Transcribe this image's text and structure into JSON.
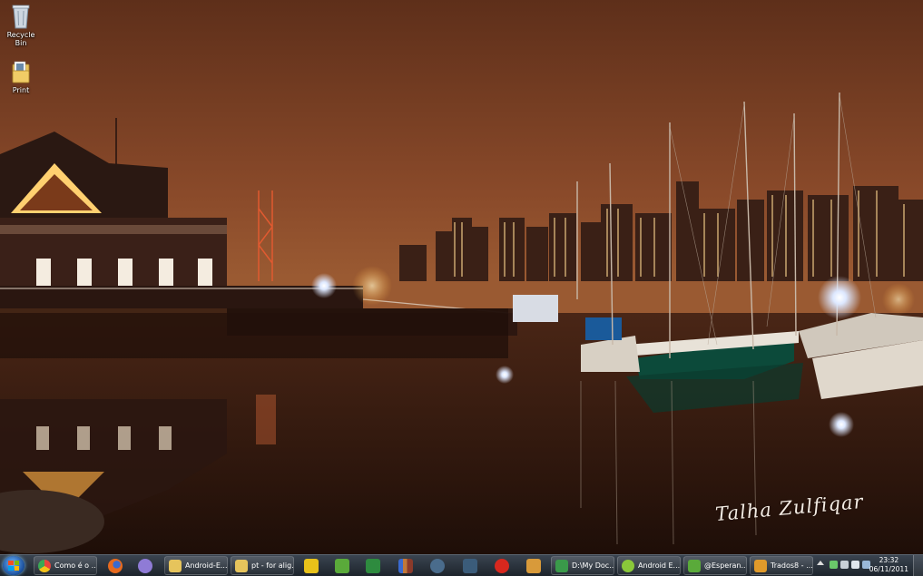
{
  "desktop": {
    "icons": [
      {
        "label": "Recycle Bin",
        "icon": "recycle-bin-icon"
      },
      {
        "label": "Print",
        "icon": "folder-print-icon"
      }
    ],
    "wallpaper": {
      "description_icon": "harbor-night-wallpaper",
      "signature": "Talha Zulfiqar"
    }
  },
  "taskbar": {
    "start_icon": "windows-start-icon",
    "buttons": [
      {
        "label": "Como é o ...",
        "icon": "chrome-icon",
        "color": "#e8453c"
      },
      {
        "label": "",
        "icon": "firefox-icon",
        "color": "#e66a1f"
      },
      {
        "label": "",
        "icon": "pidgin-icon",
        "color": "#8f7bd6"
      },
      {
        "label": "Android-E...",
        "icon": "folder-icon",
        "color": "#e6c45c"
      },
      {
        "label": "pt - for alig...",
        "icon": "folder-icon",
        "color": "#e6c45c"
      },
      {
        "label": "",
        "icon": "mail-app-icon",
        "color": "#e8c21a"
      },
      {
        "label": "",
        "icon": "evernote-icon",
        "color": "#5aaa3a"
      },
      {
        "label": "",
        "icon": "excel-icon",
        "color": "#2e8b3f"
      },
      {
        "label": "",
        "icon": "library-icon",
        "color": "#c0783a"
      },
      {
        "label": "",
        "icon": "steam-icon",
        "color": "#4a6c8c"
      },
      {
        "label": "",
        "icon": "lightroom-icon",
        "color": "#3b5c7a"
      },
      {
        "label": "",
        "icon": "tomato-timer-icon",
        "color": "#d8281e"
      },
      {
        "label": "",
        "icon": "book-icon",
        "color": "#d89a3a"
      },
      {
        "label": "D:\\My Doc...",
        "icon": "android-folder-icon",
        "color": "#3a9a4a"
      },
      {
        "label": "Android E...",
        "icon": "android-icon",
        "color": "#8ac83a"
      },
      {
        "label": "@Esperan...",
        "icon": "evernote-icon",
        "color": "#5aaa3a"
      },
      {
        "label": "Trados8 - ...",
        "icon": "trados-icon",
        "color": "#e09a2a"
      }
    ],
    "tray": {
      "icons": [
        "show-hidden-icons-icon",
        "network-icon",
        "shield-icon",
        "speaker-icon",
        "monitor-icon"
      ],
      "time": "23:32",
      "date": "06/11/2011"
    }
  }
}
